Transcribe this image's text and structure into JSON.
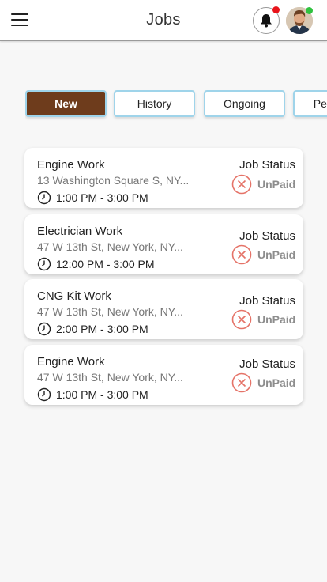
{
  "header": {
    "title": "Jobs",
    "notification_dot_color": "#e8141b",
    "online_dot_color": "#2fc23f"
  },
  "tabs": [
    {
      "label": "New",
      "active": true
    },
    {
      "label": "History",
      "active": false
    },
    {
      "label": "Ongoing",
      "active": false
    },
    {
      "label": "Pending",
      "active": false
    }
  ],
  "jobs": [
    {
      "title": "Engine Work",
      "address": "13 Washington Square S, NY...",
      "time": "1:00 PM - 3:00 PM",
      "status_label": "Job Status",
      "status": "UnPaid"
    },
    {
      "title": "Electrician Work",
      "address": "47 W 13th St, New York, NY...",
      "time": "12:00 PM - 3:00 PM",
      "status_label": "Job Status",
      "status": "UnPaid"
    },
    {
      "title": "CNG Kit Work",
      "address": "47 W 13th St, New York, NY...",
      "time": "2:00 PM - 3:00 PM",
      "status_label": "Job Status",
      "status": "UnPaid"
    },
    {
      "title": "Engine Work",
      "address": "47 W 13th St, New York, NY...",
      "time": "1:00 PM - 3:00 PM",
      "status_label": "Job Status",
      "status": "UnPaid"
    }
  ],
  "colors": {
    "active_tab": "#6e3c1c",
    "tab_border": "#9fd4ea",
    "unpaid_icon": "#e57368"
  }
}
